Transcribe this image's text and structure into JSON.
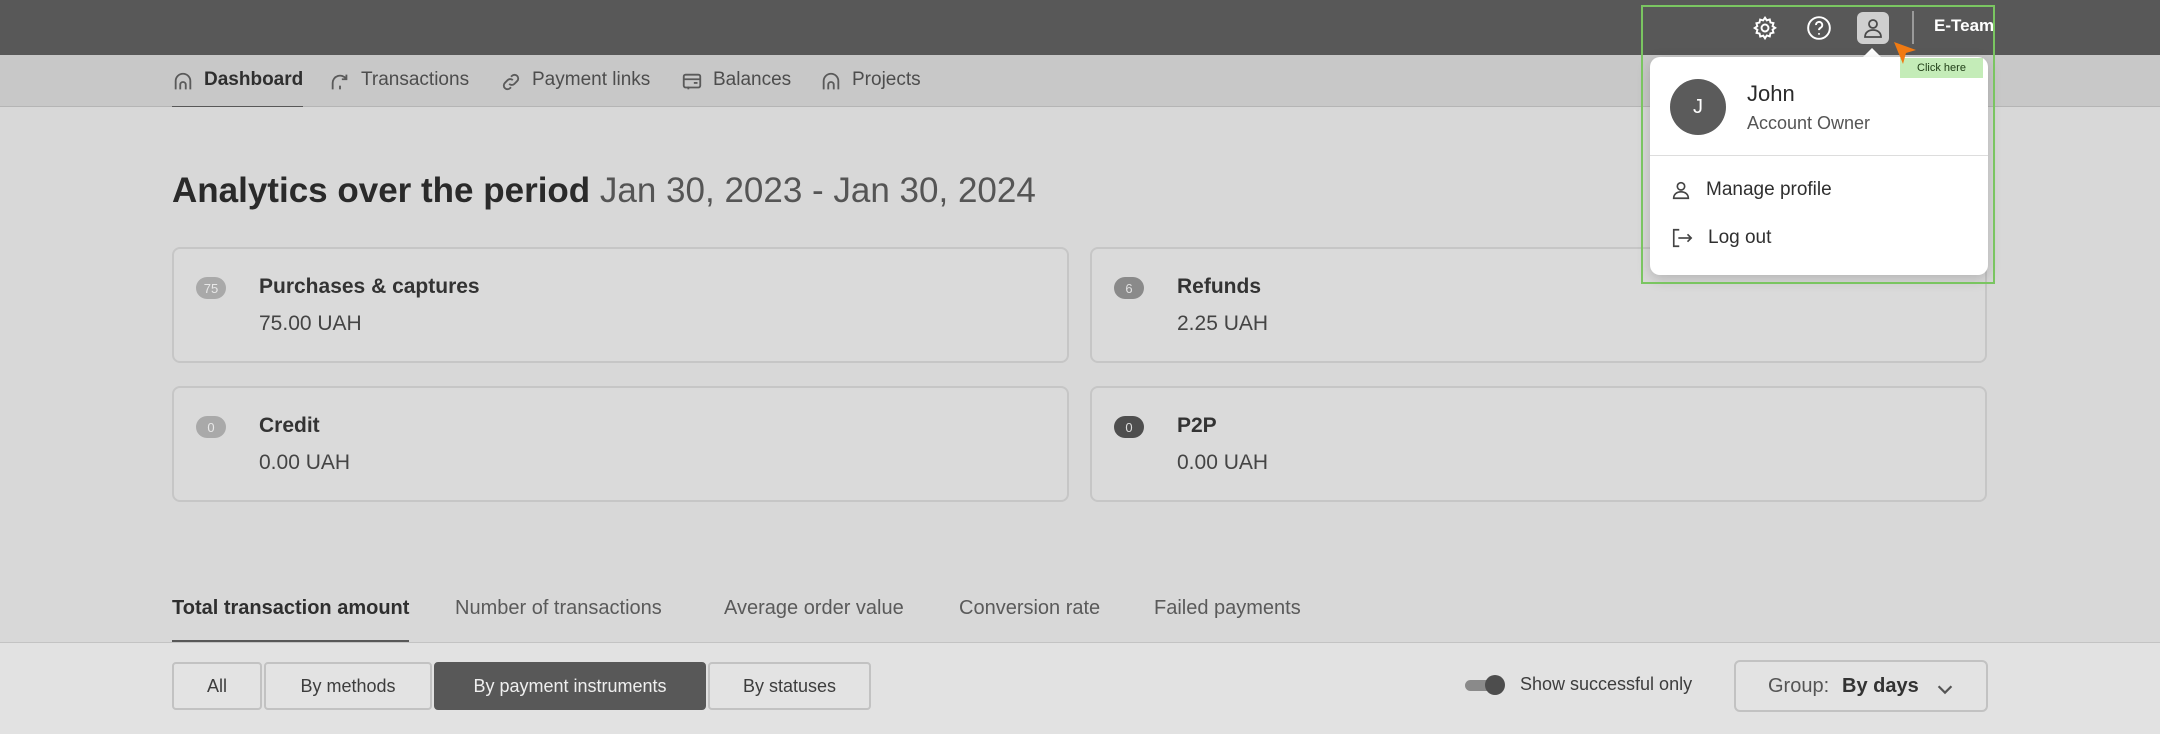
{
  "topbar": {
    "team_label": "E-Team",
    "icons": [
      "gear-icon",
      "help-icon",
      "user-icon"
    ]
  },
  "nav": {
    "items": [
      {
        "label": "Dashboard",
        "icon": "home-icon",
        "active": true
      },
      {
        "label": "Transactions",
        "icon": "refresh-icon",
        "active": false
      },
      {
        "label": "Payment links",
        "icon": "link-icon",
        "active": false
      },
      {
        "label": "Balances",
        "icon": "balance-icon",
        "active": false
      },
      {
        "label": "Projects",
        "icon": "home-icon",
        "active": false
      }
    ]
  },
  "analytics": {
    "heading": "Analytics over the period",
    "period": "Jan 30, 2023 - Jan 30, 2024"
  },
  "cards": [
    {
      "badge": "75",
      "title": "Purchases & captures",
      "value": "75.00 UAH"
    },
    {
      "badge": "6",
      "title": "Refunds",
      "value": "2.25 UAH"
    },
    {
      "badge": "0",
      "title": "Credit",
      "value": "0.00 UAH"
    },
    {
      "badge": "0",
      "title": "P2P",
      "value": "0.00 UAH"
    }
  ],
  "metric_tabs": [
    {
      "label": "Total transaction amount",
      "active": true
    },
    {
      "label": "Number of transactions",
      "active": false
    },
    {
      "label": "Average order value",
      "active": false
    },
    {
      "label": "Conversion rate",
      "active": false
    },
    {
      "label": "Failed payments",
      "active": false
    }
  ],
  "filters": {
    "segments": [
      {
        "label": "All",
        "active": false
      },
      {
        "label": "By methods",
        "active": false
      },
      {
        "label": "By payment instruments",
        "active": true
      },
      {
        "label": "By statuses",
        "active": false
      }
    ],
    "toggle_label": "Show successful only",
    "toggle_on": true,
    "group_label": "Group:",
    "group_value": "By days"
  },
  "user_menu": {
    "avatar_initial": "J",
    "name": "John",
    "role": "Account Owner",
    "items": [
      {
        "label": "Manage profile",
        "icon": "user-icon"
      },
      {
        "label": "Log out",
        "icon": "logout-icon"
      }
    ],
    "hint": "Click here"
  },
  "colors": {
    "topbar": "#585858",
    "highlight": "#7ac561",
    "cursor": "#f07a12",
    "hint_bg": "#c4ecb8"
  }
}
